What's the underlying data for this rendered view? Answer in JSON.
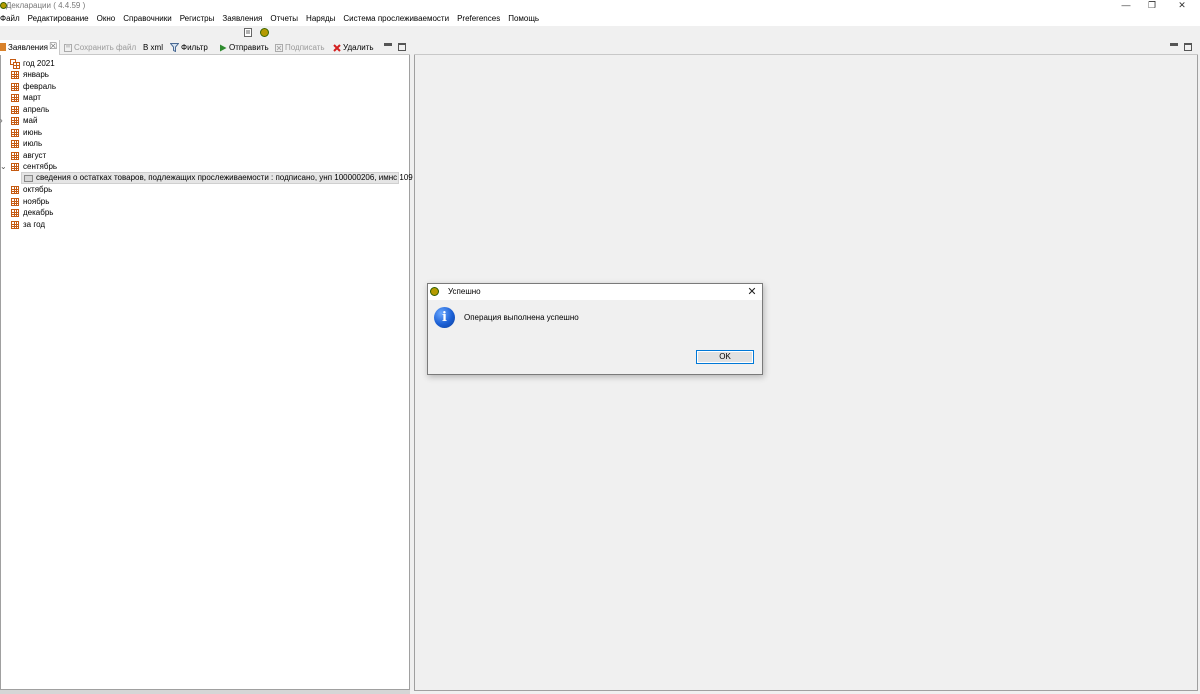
{
  "window": {
    "title": "Декларации ( 4.4.59 )",
    "controls": {
      "minimize": "—",
      "restore": "❐",
      "close": "✕"
    }
  },
  "menu": {
    "items": [
      "Файл",
      "Редактирование",
      "Окно",
      "Справочники",
      "Регистры",
      "Заявления",
      "Отчеты",
      "Наряды",
      "Система прослеживаемости",
      "Preferences",
      "Помощь"
    ]
  },
  "left_panel": {
    "tab_label": "Заявления",
    "tab_close": "☒",
    "toolbar": {
      "save_file": "Сохранить файл",
      "to_xml": "В xml",
      "filter": "Фильтр",
      "send": "Отправить",
      "sign": "Подписать",
      "delete": "Удалить"
    },
    "tree": {
      "root": "год 2021",
      "months": [
        "январь",
        "февраль",
        "март",
        "апрель",
        "май",
        "июнь",
        "июль",
        "август",
        "сентябрь"
      ],
      "document": "сведения о остатках товаров, подлежащих прослеживаемости : подписано, унп 100000206, имнс 109",
      "months_after": [
        "октябрь",
        "ноябрь",
        "декабрь",
        "за год"
      ],
      "expanders": {
        "collapsed": "›",
        "expanded": "⌄"
      }
    }
  },
  "dialog": {
    "title": "Успешно",
    "close": "✕",
    "icon": "info-icon",
    "icon_glyph": "i",
    "message": "Операция выполнена успешно",
    "ok_label": "OK"
  },
  "colors": {
    "accent": "#0078d7",
    "tree_icon": "#c55a11",
    "app_icon": "#b59a00",
    "send_icon": "#2e8b2e",
    "delete_icon": "#d32020"
  }
}
